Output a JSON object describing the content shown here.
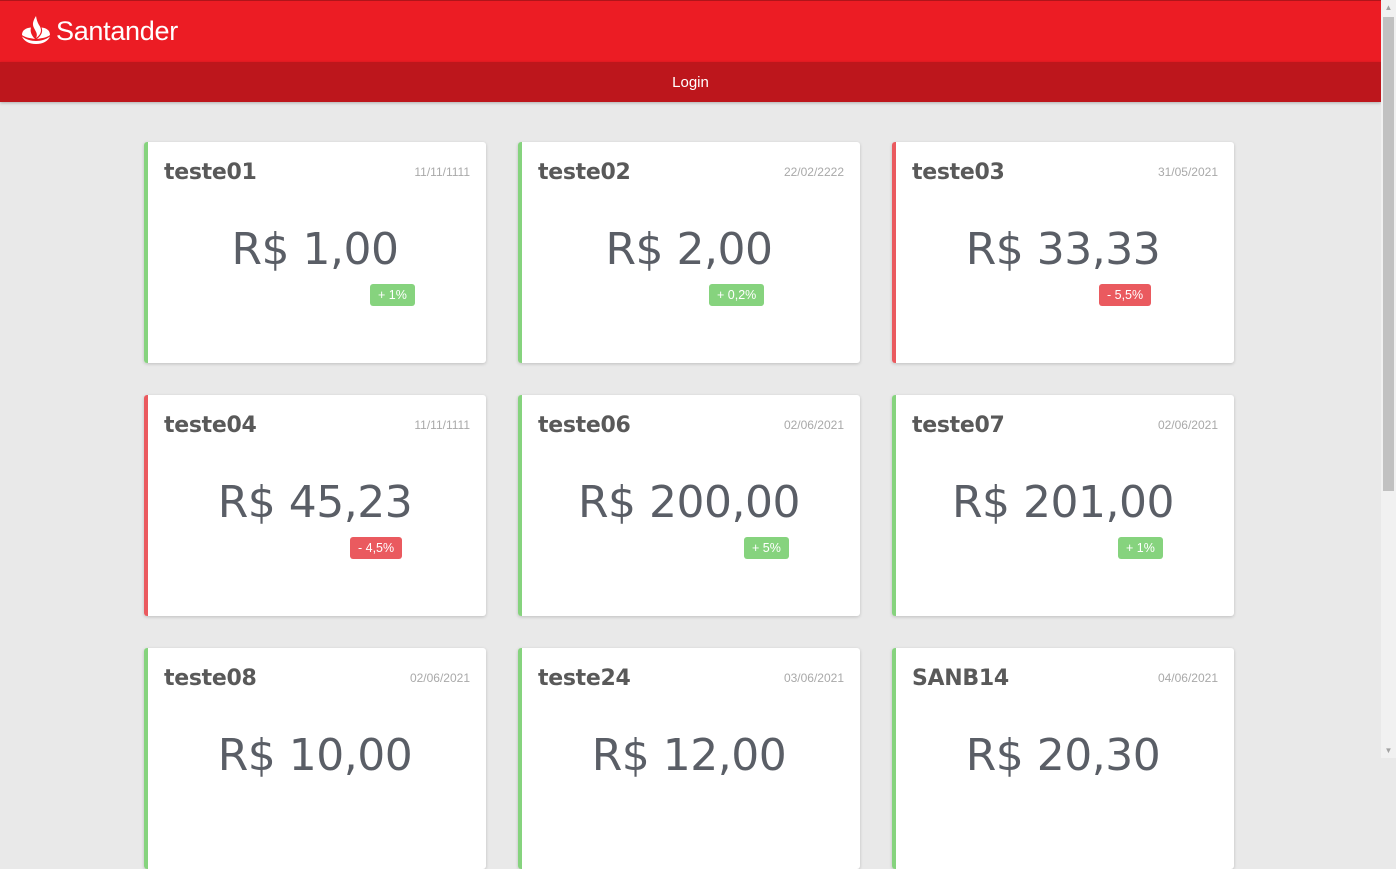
{
  "brand": {
    "name": "Santander"
  },
  "nav": {
    "login_label": "Login"
  },
  "colors": {
    "primary": "#ec1c24",
    "nav": "#bd161c",
    "positive": "#86d37e",
    "negative": "#ea5a5f",
    "background": "#e9e9e9"
  },
  "cards": [
    {
      "name": "teste01",
      "date": "11/11/1111",
      "value": "R$ 1,00",
      "change": "+ 1%",
      "trend": "up"
    },
    {
      "name": "teste02",
      "date": "22/02/2222",
      "value": "R$ 2,00",
      "change": "+ 0,2%",
      "trend": "up"
    },
    {
      "name": "teste03",
      "date": "31/05/2021",
      "value": "R$ 33,33",
      "change": "- 5,5%",
      "trend": "down"
    },
    {
      "name": "teste04",
      "date": "11/11/1111",
      "value": "R$ 45,23",
      "change": "- 4,5%",
      "trend": "down"
    },
    {
      "name": "teste06",
      "date": "02/06/2021",
      "value": "R$ 200,00",
      "change": "+ 5%",
      "trend": "up"
    },
    {
      "name": "teste07",
      "date": "02/06/2021",
      "value": "R$ 201,00",
      "change": "+ 1%",
      "trend": "up"
    },
    {
      "name": "teste08",
      "date": "02/06/2021",
      "value": "R$ 10,00",
      "trend": "up"
    },
    {
      "name": "teste24",
      "date": "03/06/2021",
      "value": "R$ 12,00",
      "trend": "up"
    },
    {
      "name": "SANB14",
      "date": "04/06/2021",
      "value": "R$ 20,30",
      "trend": "up"
    }
  ]
}
